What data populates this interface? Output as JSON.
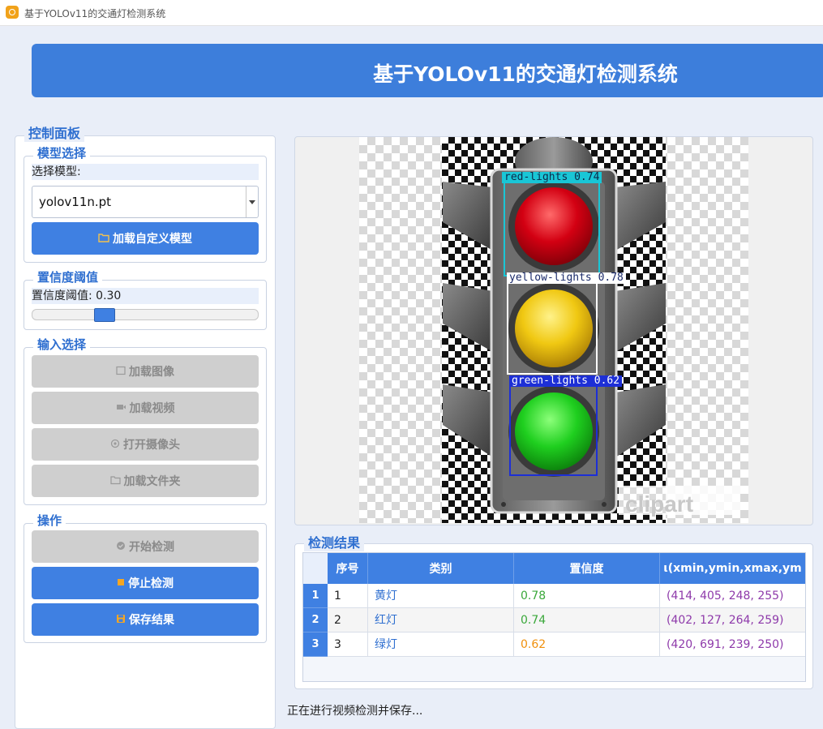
{
  "window": {
    "title": "基于YOLOv11的交通灯检测系统"
  },
  "banner": {
    "title": "基于YOLOv11的交通灯检测系统"
  },
  "control_panel": {
    "title": "控制面板",
    "model_group": {
      "title": "模型选择",
      "label": "选择模型:",
      "selected_model": "yolov11n.pt",
      "load_button": "加载自定义模型"
    },
    "confidence_group": {
      "title": "置信度阈值",
      "label": "置信度阈值: 0.30",
      "value": 0.3
    },
    "input_group": {
      "title": "输入选择",
      "load_image": "加载图像",
      "load_video": "加载视频",
      "open_camera": "打开摄像头",
      "load_folder": "加载文件夹"
    },
    "action_group": {
      "title": "操作",
      "start": "开始检测",
      "stop": "停止检测",
      "save": "保存结果"
    }
  },
  "detections": [
    {
      "label": "red-lights 0.74",
      "color": "#19c6d6"
    },
    {
      "label": "yellow-lights 0.78",
      "color": "#ffffff"
    },
    {
      "label": "green-lights 0.62",
      "color": "#1d2fd6"
    }
  ],
  "results": {
    "title": "检测结果",
    "columns": [
      "序号",
      "类别",
      "置信度",
      "ι(xmin,ymin,xmax,ym"
    ],
    "rows": [
      {
        "index": "1",
        "num": "1",
        "class": "黄灯",
        "conf": "0.78",
        "conf_color": "#3aa83a",
        "bbox": "(414, 405, 248, 255)"
      },
      {
        "index": "2",
        "num": "2",
        "class": "红灯",
        "conf": "0.74",
        "conf_color": "#3aa83a",
        "bbox": "(402, 127, 264, 259)"
      },
      {
        "index": "3",
        "num": "3",
        "class": "绿灯",
        "conf": "0.62",
        "conf_color": "#f0900c",
        "bbox": "(420, 691, 239, 250)"
      }
    ]
  },
  "status": "正在进行视频检测并保存..."
}
